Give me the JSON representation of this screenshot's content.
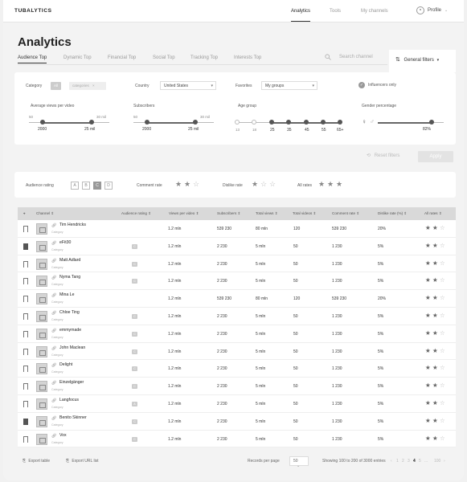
{
  "brand": "TUBALYTICS",
  "topnav": {
    "items": [
      "Analytics",
      "Tools",
      "My channels"
    ],
    "active": "Analytics",
    "profile": "Profile"
  },
  "page_title": "Analytics",
  "tabs": [
    "Audience Top",
    "Dynamic Top",
    "Financial Top",
    "Social Top",
    "Tracking Top",
    "Interests Top"
  ],
  "search_placeholder": "Search channel",
  "general_filters_label": "General filters",
  "filters": {
    "category_label": "Category",
    "category_chip_all": "All",
    "category_chip": "categories",
    "country_label": "Country",
    "country_value": "United States",
    "favorites_label": "Favorites",
    "favorites_value": "My groups",
    "influencers_only": "Influencers only",
    "avg_views_label": "Average views per video",
    "avg_views_min_label": "50",
    "avg_views_max_label": "30 mil",
    "avg_views_from": "2000",
    "avg_views_to": "25 mil",
    "subscribers_label": "Subscribers",
    "subs_min_label": "50",
    "subs_max_label": "30 mil",
    "subs_from": "2000",
    "subs_to": "25 mil",
    "age_group_label": "Age group",
    "age_ticks": [
      "13",
      "18",
      "25",
      "35",
      "45",
      "55",
      "65+"
    ],
    "gender_label": "Gender percentage",
    "gender_value": "82%",
    "gender_fraction": 0.82,
    "reset_label": "Reset filters",
    "apply_label": "Apply"
  },
  "ratings": {
    "audience_label": "Audience rating",
    "audience_options": [
      "A",
      "B",
      "C",
      "D"
    ],
    "audience_selected": "C",
    "comment_label": "Comment rate",
    "comment_stars": 2,
    "dislike_label": "Dislike rate",
    "dislike_stars": 1,
    "all_label": "All rates",
    "all_stars": 3
  },
  "table": {
    "headers": [
      "Channel",
      "Audience rating",
      "Views per video",
      "Subscribers",
      "Total views",
      "Total videos",
      "Comment rate",
      "Dislike rate (%)",
      "All rates"
    ],
    "rows": [
      {
        "name": "Tim Hendricks",
        "category": "Category",
        "rating": "",
        "views": "1.2 mln",
        "subs": "539 230",
        "total_views": "80 mln",
        "videos": "120",
        "comment": "539 230",
        "dislike": "20%",
        "bookmarked": false
      },
      {
        "name": "eFit30",
        "category": "Category",
        "rating": "C",
        "views": "1.2 mln",
        "subs": "2 230",
        "total_views": "5 mln",
        "videos": "50",
        "comment": "1 230",
        "dislike": "5%",
        "bookmarked": true
      },
      {
        "name": "Matt Adlard",
        "category": "Category",
        "rating": "C",
        "views": "1.2 mln",
        "subs": "2 230",
        "total_views": "5 mln",
        "videos": "50",
        "comment": "1 230",
        "dislike": "5%",
        "bookmarked": false
      },
      {
        "name": "Nyma Tang",
        "category": "Category",
        "rating": "C",
        "views": "1.2 mln",
        "subs": "2 230",
        "total_views": "5 mln",
        "videos": "50",
        "comment": "1 230",
        "dislike": "5%",
        "bookmarked": false
      },
      {
        "name": "Mina Le",
        "category": "Category",
        "rating": "",
        "views": "1.2 mln",
        "subs": "539 230",
        "total_views": "80 mln",
        "videos": "120",
        "comment": "539 230",
        "dislike": "20%",
        "bookmarked": false
      },
      {
        "name": "Chloe Ting",
        "category": "Category",
        "rating": "C",
        "views": "1.2 mln",
        "subs": "2 230",
        "total_views": "5 mln",
        "videos": "50",
        "comment": "1 230",
        "dislike": "5%",
        "bookmarked": false
      },
      {
        "name": "emmymade",
        "category": "Category",
        "rating": "C",
        "views": "1.2 mln",
        "subs": "2 230",
        "total_views": "5 mln",
        "videos": "50",
        "comment": "1 230",
        "dislike": "5%",
        "bookmarked": false
      },
      {
        "name": "John Maclean",
        "category": "Category",
        "rating": "C",
        "views": "1.2 mln",
        "subs": "2 230",
        "total_views": "5 mln",
        "videos": "50",
        "comment": "1 230",
        "dislike": "5%",
        "bookmarked": false
      },
      {
        "name": "Delight",
        "category": "Category",
        "rating": "C",
        "views": "1.2 mln",
        "subs": "2 230",
        "total_views": "5 mln",
        "videos": "50",
        "comment": "1 230",
        "dislike": "5%",
        "bookmarked": false
      },
      {
        "name": "Einzelgänger",
        "category": "Category",
        "rating": "C",
        "views": "1.2 mln",
        "subs": "2 230",
        "total_views": "5 mln",
        "videos": "50",
        "comment": "1 230",
        "dislike": "5%",
        "bookmarked": false
      },
      {
        "name": "Langfocus",
        "category": "Category",
        "rating": "A",
        "views": "1.2 mln",
        "subs": "2 230",
        "total_views": "5 mln",
        "videos": "50",
        "comment": "1 230",
        "dislike": "5%",
        "bookmarked": false
      },
      {
        "name": "Benito Skinner",
        "category": "Category",
        "rating": "C",
        "views": "1.2 mln",
        "subs": "2 230",
        "total_views": "5 mln",
        "videos": "50",
        "comment": "1 230",
        "dislike": "5%",
        "bookmarked": true
      },
      {
        "name": "Vox",
        "category": "Category",
        "rating": "C",
        "views": "1.2 mln",
        "subs": "2 230",
        "total_views": "5 mln",
        "videos": "50",
        "comment": "1 230",
        "dislike": "5%",
        "bookmarked": false
      }
    ]
  },
  "footer": {
    "export_table": "Export table",
    "export_urls": "Export URL list",
    "records_label": "Records per page",
    "records_value": "50",
    "showing": "Showing 100 to 200 of 3000 entries",
    "pages": [
      "‹",
      "1",
      "2",
      "3",
      "4",
      "5",
      "...",
      "100",
      "›"
    ],
    "current_page": "4"
  }
}
